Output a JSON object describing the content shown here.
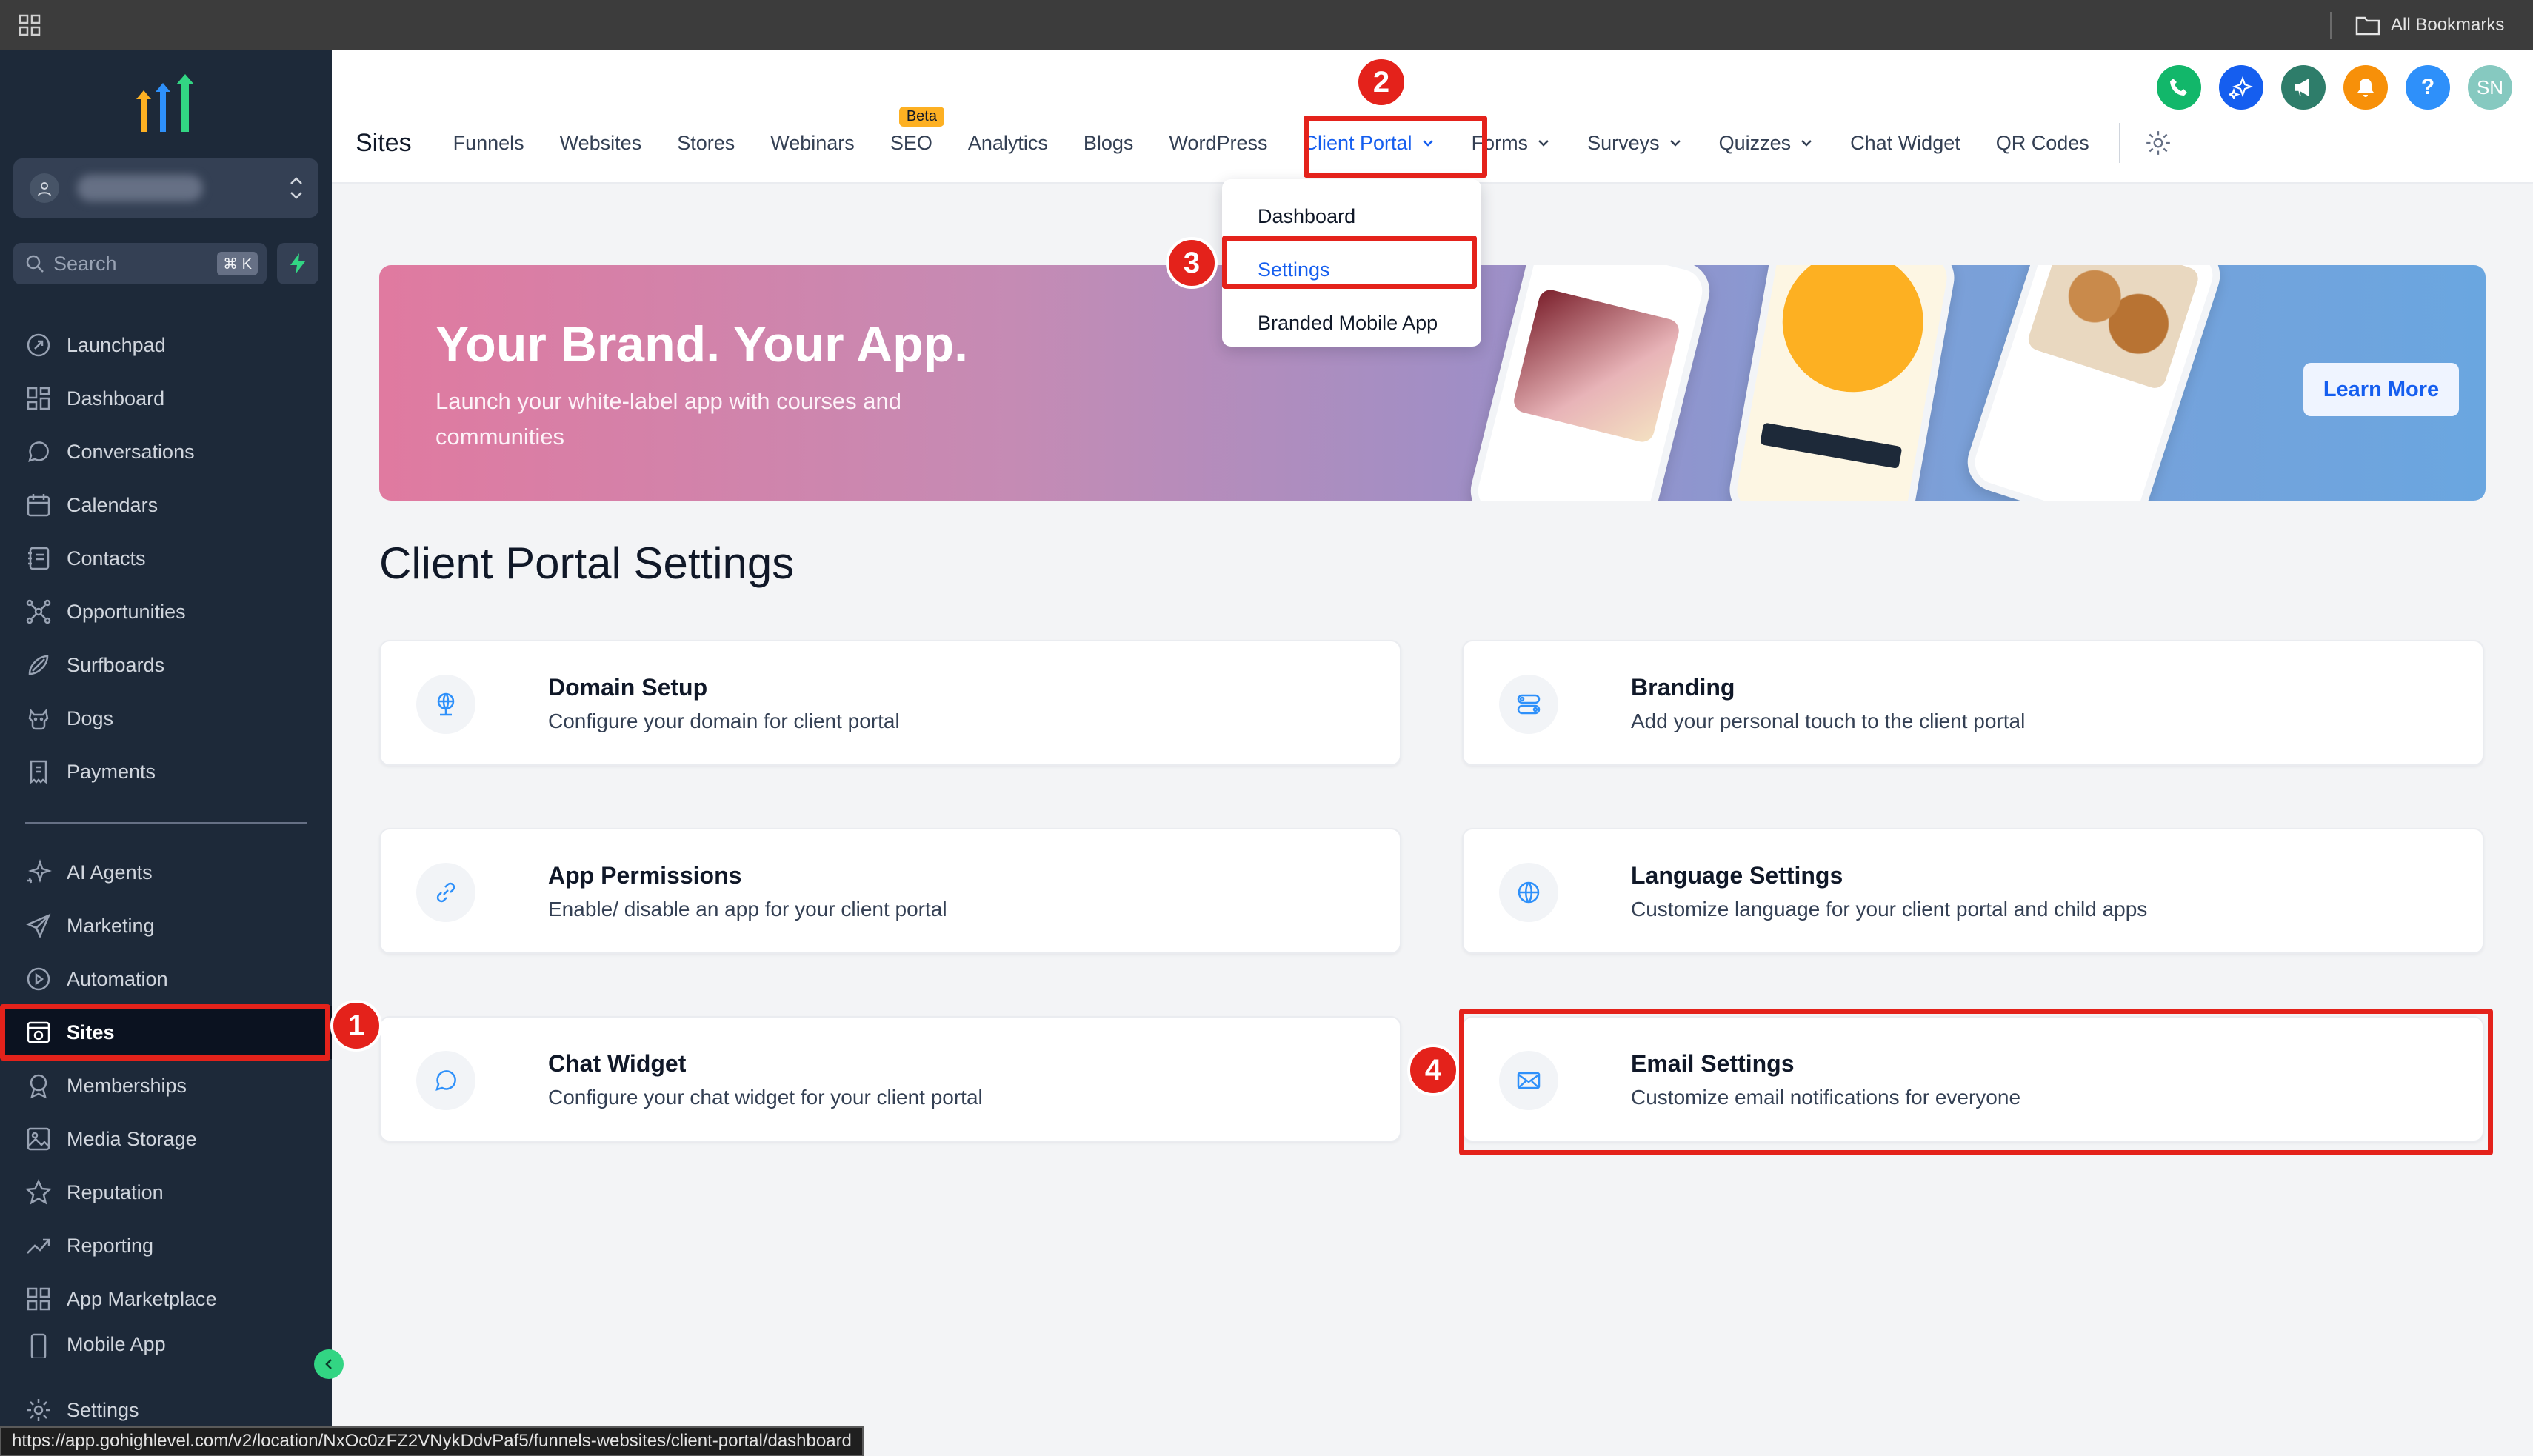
{
  "browser": {
    "bookmarks_label": "All Bookmarks"
  },
  "sidebar": {
    "search_placeholder": "Search",
    "search_shortcut": "⌘ K",
    "nav_top": [
      {
        "label": "Launchpad",
        "icon": "rocket-icon"
      },
      {
        "label": "Dashboard",
        "icon": "grid-icon"
      },
      {
        "label": "Conversations",
        "icon": "chat-icon"
      },
      {
        "label": "Calendars",
        "icon": "calendar-icon"
      },
      {
        "label": "Contacts",
        "icon": "contacts-icon"
      },
      {
        "label": "Opportunities",
        "icon": "network-icon"
      },
      {
        "label": "Surfboards",
        "icon": "surfboard-icon"
      },
      {
        "label": "Dogs",
        "icon": "dog-icon"
      },
      {
        "label": "Payments",
        "icon": "receipt-icon"
      }
    ],
    "nav_bottom": [
      {
        "label": "AI Agents",
        "icon": "sparkle-icon"
      },
      {
        "label": "Marketing",
        "icon": "send-icon"
      },
      {
        "label": "Automation",
        "icon": "automation-icon"
      },
      {
        "label": "Sites",
        "icon": "browser-icon"
      },
      {
        "label": "Memberships",
        "icon": "award-icon"
      },
      {
        "label": "Media Storage",
        "icon": "image-icon"
      },
      {
        "label": "Reputation",
        "icon": "star-icon"
      },
      {
        "label": "Reporting",
        "icon": "trend-icon"
      },
      {
        "label": "App Marketplace",
        "icon": "apps-icon"
      },
      {
        "label": "Mobile App",
        "icon": "phone-icon"
      }
    ],
    "settings_label": "Settings",
    "active_item": "Sites"
  },
  "status_url": "https://app.gohighlevel.com/v2/location/NxOc0zFZ2VNykDdvPaf5/funnels-websites/client-portal/dashboard",
  "header": {
    "avatar_initials": "SN",
    "help_label": "?",
    "title": "Sites",
    "beta_badge": "Beta",
    "tabs": {
      "funnels": "Funnels",
      "websites": "Websites",
      "stores": "Stores",
      "webinars": "Webinars",
      "seo": "SEO",
      "analytics": "Analytics",
      "blogs": "Blogs",
      "wordpress": "WordPress",
      "client_portal": "Client Portal",
      "forms": "Forms",
      "surveys": "Surveys",
      "quizzes": "Quizzes",
      "chat_widget": "Chat Widget",
      "qr_codes": "QR Codes"
    }
  },
  "dropdown": {
    "items": [
      "Dashboard",
      "Settings",
      "Branded Mobile App"
    ],
    "active": "Settings"
  },
  "banner": {
    "title": "Your Brand. Your App.",
    "subtitle": "Launch your white-label app with courses and communities",
    "button": "Learn More"
  },
  "page_title": "Client Portal Settings",
  "cards": [
    {
      "title": "Domain Setup",
      "desc": "Configure your domain for client portal",
      "icon": "globe-pin-icon"
    },
    {
      "title": "Branding",
      "desc": "Add your personal touch to the client portal",
      "icon": "toggles-icon"
    },
    {
      "title": "App Permissions",
      "desc": "Enable/ disable an app for your client portal",
      "icon": "link-icon"
    },
    {
      "title": "Language Settings",
      "desc": "Customize language for your client portal and child apps",
      "icon": "globe-icon"
    },
    {
      "title": "Chat Widget",
      "desc": "Configure your chat widget for your client portal",
      "icon": "chat-bubble-icon"
    },
    {
      "title": "Email Settings",
      "desc": "Customize email notifications for everyone",
      "icon": "mail-icon"
    }
  ],
  "annotations": [
    "1",
    "2",
    "3",
    "4"
  ],
  "colors": {
    "accent": "#155eef",
    "highlight": "#e4221b",
    "sidebar_bg": "#1d2939"
  }
}
